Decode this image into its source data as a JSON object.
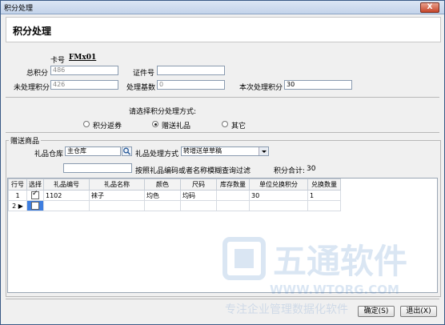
{
  "window": {
    "title": "积分处理",
    "close_label": "X"
  },
  "header": {
    "heading": "积分处理"
  },
  "card": {
    "label": "卡号",
    "number": "FMx01"
  },
  "fields": {
    "total_label": "总积分",
    "total_value": "486",
    "cert_label": "证件号",
    "cert_value": "",
    "unprocessed_label": "未处理积分",
    "unprocessed_value": "426",
    "base_label": "处理基数",
    "base_value": "0",
    "current_label": "本次处理积分",
    "current_value": "30"
  },
  "method": {
    "prompt": "请选择积分处理方式:",
    "options": [
      "积分返券",
      "赠送礼品",
      "其它"
    ],
    "selected": "赠送礼品"
  },
  "gift": {
    "group_title": "赠送商品",
    "warehouse_label": "礼品仓库",
    "warehouse_value": "主仓库",
    "method_label": "礼品处理方式",
    "method_value": "转增送单草稿",
    "filter_value": "",
    "filter_hint": "按照礼品编码或者名称模糊查询过滤",
    "total_label": "积分合计:",
    "total_value": "30"
  },
  "table": {
    "columns": [
      "行号",
      "选择",
      "礼品编号",
      "礼品名称",
      "颜色",
      "尺码",
      "库存数量",
      "单位兑换积分",
      "兑换数量"
    ],
    "rows": [
      {
        "row_no": "1",
        "selected": true,
        "code": "1102",
        "name": "袜子",
        "color": "均色",
        "size": "均码",
        "stock": "",
        "unit_points": "30",
        "qty": "1"
      },
      {
        "row_no": "2",
        "selected": false,
        "code": "",
        "name": "",
        "color": "",
        "size": "",
        "stock": "",
        "unit_points": "",
        "qty": ""
      }
    ]
  },
  "watermark": {
    "brand": "五通软件",
    "url": "WWW.WTORG.COM",
    "slogan": "专注企业管理数据化软件"
  },
  "buttons": {
    "ok_label": "确定(S)",
    "exit_label": "退出(X)"
  },
  "colors": {
    "titlebar": "#c3d3ea",
    "close": "#c6452a",
    "watermark": "#3a78c2"
  }
}
